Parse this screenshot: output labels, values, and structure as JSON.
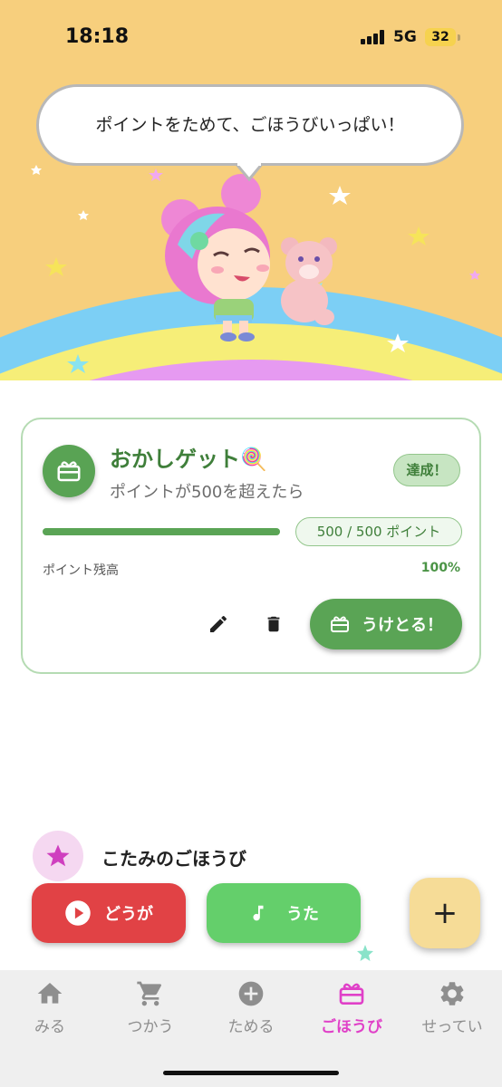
{
  "status_bar": {
    "time": "18:18",
    "network": "5G",
    "battery": "32"
  },
  "hero": {
    "speech": "ポイントをためて、ごほうびいっぱい！"
  },
  "reward_card": {
    "title": "おかしゲット🍭",
    "condition": "ポイントが500を超えたら",
    "status_badge": "達成！",
    "points_label": "500 / 500 ポイント",
    "progress_fraction": 1.0,
    "balance_label": "ポイント残高",
    "balance_percent": "100%",
    "receive_button": "うけとる！"
  },
  "player": {
    "name": "こたみのごほうび"
  },
  "actions": {
    "video": "どうが",
    "song": "うた",
    "add": "+"
  },
  "nav": {
    "items": [
      {
        "label": "みる",
        "icon": "home-icon"
      },
      {
        "label": "つかう",
        "icon": "cart-icon"
      },
      {
        "label": "ためる",
        "icon": "add-circle-icon"
      },
      {
        "label": "ごほうび",
        "icon": "gift-icon",
        "active": true
      },
      {
        "label": "せってい",
        "icon": "gear-icon"
      }
    ]
  },
  "colors": {
    "accent_green": "#5aa455",
    "active_pink": "#e040c8",
    "video_red": "#e14245",
    "song_green": "#64cf6b",
    "fab_yellow": "#f6dc97"
  }
}
